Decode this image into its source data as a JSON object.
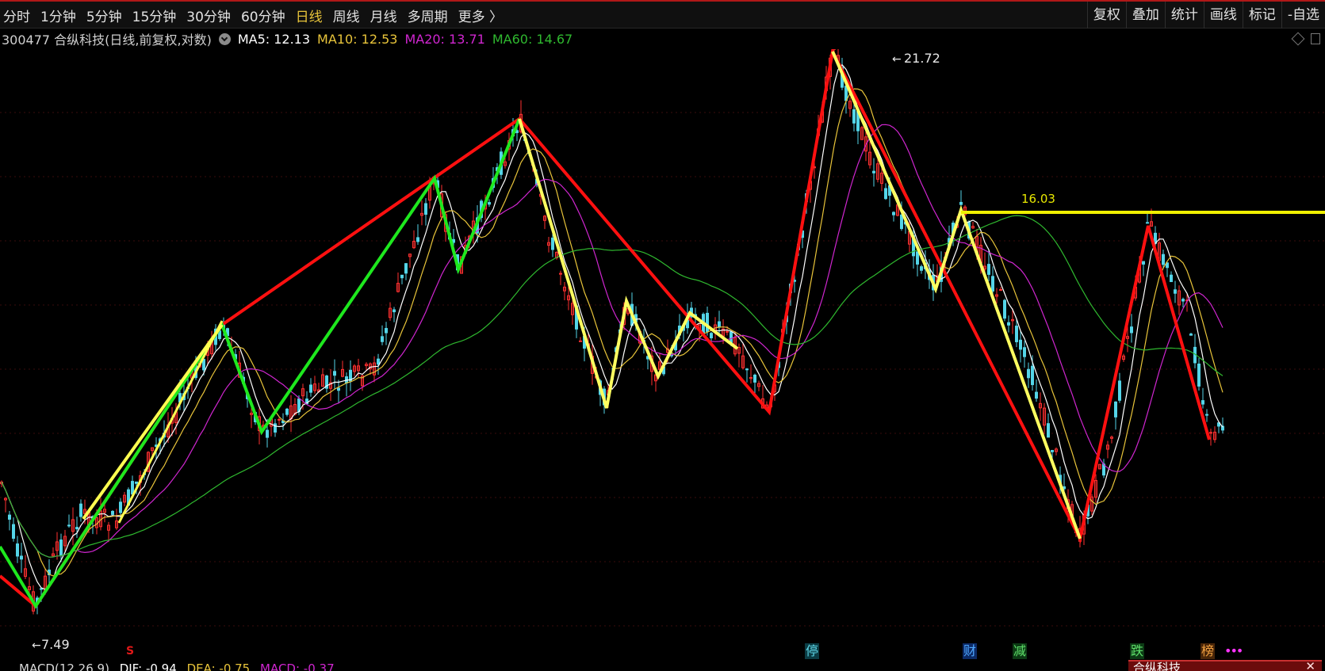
{
  "toolbar": {
    "periods": [
      "分时",
      "1分钟",
      "5分钟",
      "15分钟",
      "30分钟",
      "60分钟",
      "日线",
      "周线",
      "月线",
      "多周期",
      "更多 〉"
    ],
    "active_period": "日线",
    "tools": [
      "复权",
      "叠加",
      "统计",
      "画线",
      "标记",
      "-自选"
    ]
  },
  "stock_info": {
    "title": "300477 合纵科技(日线,前复权,对数)",
    "ma5": "MA5: 12.13",
    "ma10": "MA10: 12.53",
    "ma20": "MA20: 13.71",
    "ma60": "MA60: 14.67"
  },
  "colors": {
    "ma5": "#ffffff",
    "ma10": "#e8c43a",
    "ma20": "#d026d0",
    "ma60": "#2fb82f",
    "up": "#ff3030",
    "down": "#54d5e8"
  },
  "annotations": {
    "low_price": "7.49",
    "high_price": "21.72",
    "resistance_price": "16.03"
  },
  "markers": [
    {
      "text": "停",
      "style": "cyan"
    },
    {
      "text": "财",
      "style": "blue"
    },
    {
      "text": "减",
      "style": "green"
    },
    {
      "text": "跌",
      "style": "green"
    },
    {
      "text": "榜",
      "style": "orange"
    },
    {
      "text": "•••",
      "style": "dots"
    },
    {
      "text": "S",
      "style": "s"
    }
  ],
  "macd": {
    "label": "MACD(12,26,9)",
    "dif": "DIF: -0.94",
    "dea": "DEA: -0.75",
    "macd": "MACD: -0.37"
  },
  "popup": {
    "title": "合纵科技",
    "close": "✕"
  },
  "chart_data": {
    "type": "line",
    "ma_labels": [
      "MA5",
      "MA10",
      "MA20",
      "MA60"
    ],
    "zigzag_labels": [
      "red",
      "green",
      "yellow"
    ]
  }
}
